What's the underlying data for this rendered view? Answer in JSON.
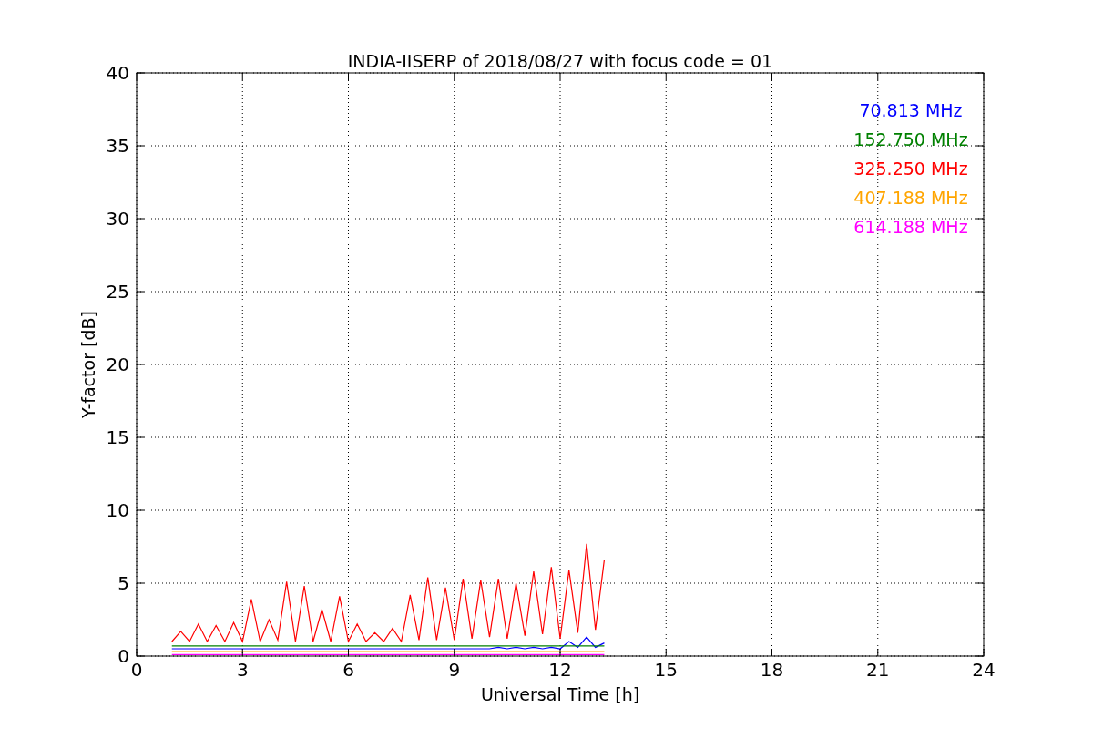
{
  "figure": {
    "chart_data": {
      "type": "line",
      "title": "INDIA-IISERP of 2018/08/27 with focus code = 01",
      "xlabel": "Universal Time [h]",
      "ylabel": "Y-factor [dB]",
      "xlim": [
        0,
        24
      ],
      "ylim": [
        0,
        40
      ],
      "xticks": [
        0,
        3,
        6,
        9,
        12,
        15,
        18,
        21,
        24
      ],
      "yticks": [
        0,
        5,
        10,
        15,
        20,
        25,
        30,
        35,
        40
      ],
      "grid": true,
      "x": [
        1,
        1.25,
        1.5,
        1.75,
        2,
        2.25,
        2.5,
        2.75,
        3,
        3.25,
        3.5,
        3.75,
        4,
        4.25,
        4.5,
        4.75,
        5,
        5.25,
        5.5,
        5.75,
        6,
        6.25,
        6.5,
        6.75,
        7,
        7.25,
        7.5,
        7.75,
        8,
        8.25,
        8.5,
        8.75,
        9,
        9.25,
        9.5,
        9.75,
        10,
        10.25,
        10.5,
        10.75,
        11,
        11.25,
        11.5,
        11.75,
        12,
        12.25,
        12.5,
        12.75,
        13,
        13.25
      ],
      "series": [
        {
          "name": "70.813 MHz",
          "color": "#0000ff",
          "values": [
            0.5,
            0.5,
            0.5,
            0.5,
            0.5,
            0.5,
            0.5,
            0.5,
            0.5,
            0.5,
            0.5,
            0.5,
            0.5,
            0.5,
            0.5,
            0.5,
            0.5,
            0.5,
            0.5,
            0.5,
            0.5,
            0.5,
            0.5,
            0.5,
            0.5,
            0.5,
            0.5,
            0.5,
            0.5,
            0.5,
            0.5,
            0.5,
            0.5,
            0.5,
            0.5,
            0.5,
            0.5,
            0.6,
            0.5,
            0.6,
            0.5,
            0.6,
            0.5,
            0.6,
            0.5,
            1.0,
            0.6,
            1.3,
            0.6,
            0.9
          ]
        },
        {
          "name": "152.750 MHz",
          "color": "#008000",
          "values": [
            0.7,
            0.7,
            0.7,
            0.7,
            0.7,
            0.7,
            0.7,
            0.7,
            0.7,
            0.7,
            0.7,
            0.7,
            0.7,
            0.7,
            0.7,
            0.7,
            0.7,
            0.7,
            0.7,
            0.7,
            0.7,
            0.7,
            0.7,
            0.7,
            0.7,
            0.7,
            0.7,
            0.7,
            0.7,
            0.7,
            0.7,
            0.7,
            0.7,
            0.7,
            0.7,
            0.7,
            0.7,
            0.7,
            0.7,
            0.7,
            0.7,
            0.7,
            0.7,
            0.7,
            0.7,
            0.7,
            0.7,
            0.7,
            0.7,
            0.7
          ]
        },
        {
          "name": "325.250 MHz",
          "color": "#ff0000",
          "values": [
            1.0,
            1.7,
            1.0,
            2.2,
            1.0,
            2.1,
            1.0,
            2.3,
            1.0,
            3.9,
            1.0,
            2.5,
            1.1,
            5.1,
            1.0,
            4.8,
            1.0,
            3.2,
            1.0,
            4.1,
            1.0,
            2.2,
            1.0,
            1.6,
            1.0,
            1.9,
            1.0,
            4.2,
            1.1,
            5.4,
            1.1,
            4.7,
            1.1,
            5.3,
            1.2,
            5.2,
            1.3,
            5.3,
            1.2,
            5.0,
            1.4,
            5.8,
            1.5,
            6.1,
            1.2,
            5.9,
            1.6,
            7.7,
            1.8,
            6.6
          ]
        },
        {
          "name": "407.188 MHz",
          "color": "#ffa500",
          "values": [
            0.3,
            0.3,
            0.3,
            0.3,
            0.3,
            0.3,
            0.3,
            0.3,
            0.3,
            0.3,
            0.3,
            0.3,
            0.3,
            0.3,
            0.3,
            0.3,
            0.3,
            0.3,
            0.3,
            0.3,
            0.3,
            0.3,
            0.3,
            0.3,
            0.3,
            0.3,
            0.3,
            0.3,
            0.3,
            0.3,
            0.3,
            0.3,
            0.3,
            0.3,
            0.3,
            0.3,
            0.3,
            0.3,
            0.3,
            0.3,
            0.3,
            0.3,
            0.3,
            0.3,
            0.3,
            0.3,
            0.3,
            0.3,
            0.3,
            0.3
          ]
        },
        {
          "name": "614.188 MHz",
          "color": "#ff00ff",
          "values": [
            0.1,
            0.1,
            0.1,
            0.1,
            0.1,
            0.1,
            0.1,
            0.1,
            0.1,
            0.1,
            0.1,
            0.1,
            0.1,
            0.1,
            0.1,
            0.1,
            0.1,
            0.1,
            0.1,
            0.1,
            0.1,
            0.1,
            0.1,
            0.1,
            0.1,
            0.1,
            0.1,
            0.1,
            0.1,
            0.1,
            0.1,
            0.1,
            0.1,
            0.1,
            0.1,
            0.1,
            0.1,
            0.1,
            0.1,
            0.1,
            0.1,
            0.1,
            0.1,
            0.1,
            0.1,
            0.1,
            0.1,
            0.1,
            0.1,
            0.1
          ]
        }
      ]
    }
  }
}
